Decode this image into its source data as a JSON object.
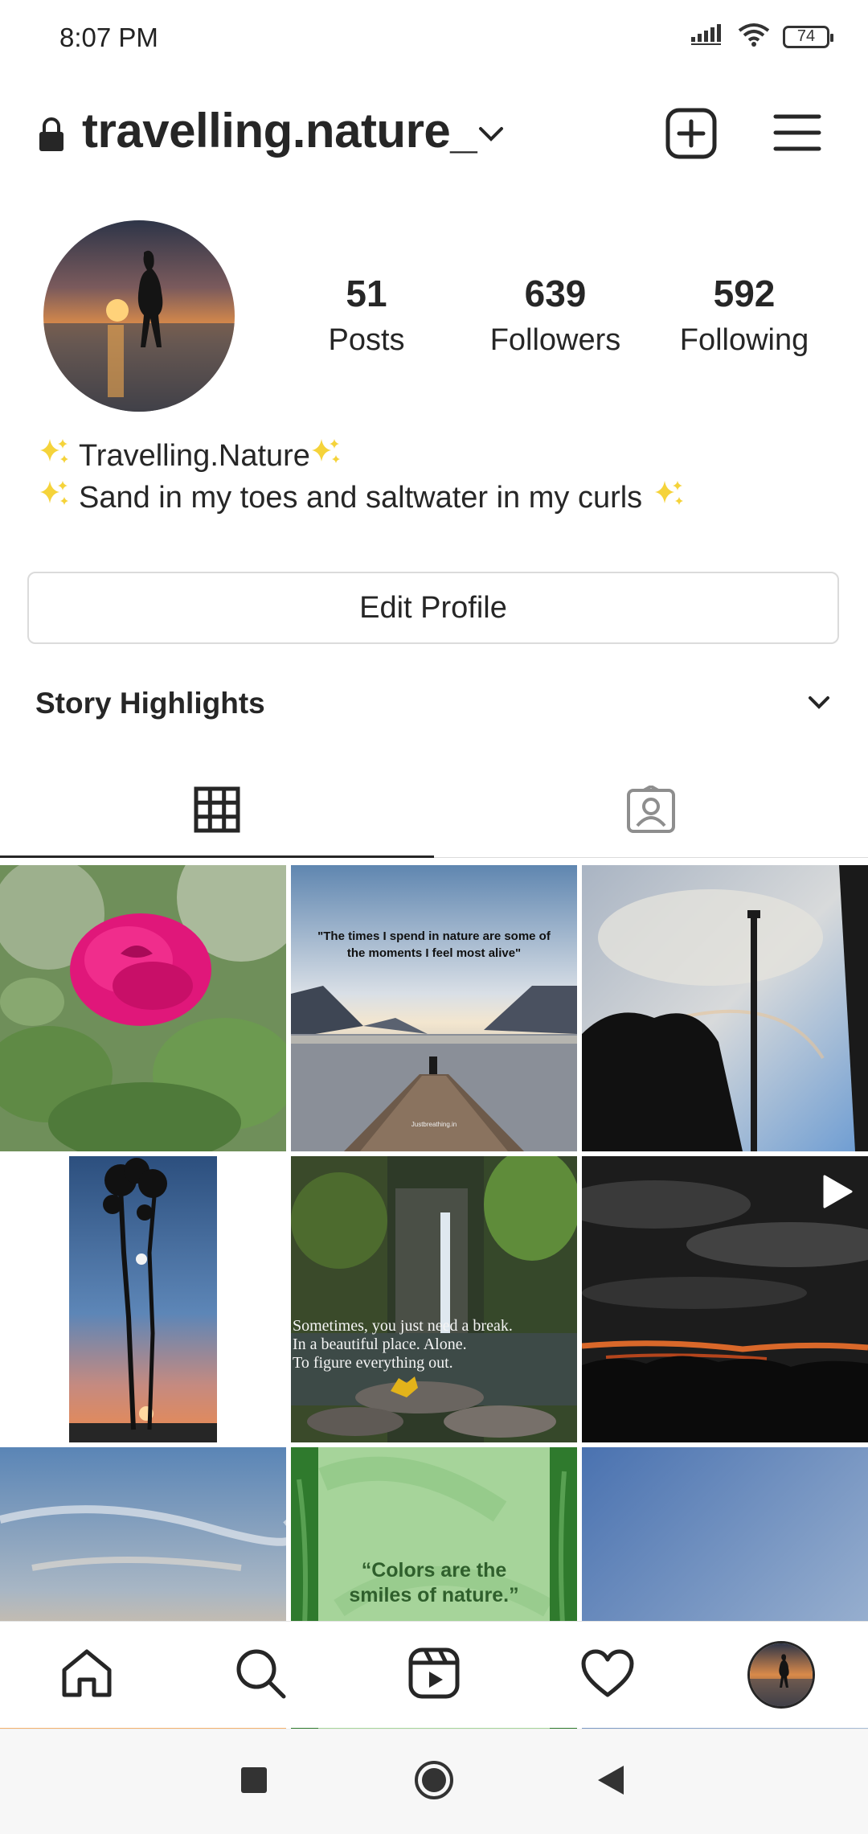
{
  "status_bar": {
    "time": "8:07 PM",
    "battery": "74",
    "icons": [
      "signal-icon",
      "wifi-icon",
      "battery-icon"
    ]
  },
  "header": {
    "username": "travelling.nature_",
    "icons": [
      "lock-icon",
      "chevron-down-icon",
      "new-post-icon",
      "menu-icon"
    ]
  },
  "profile": {
    "stats": [
      {
        "value": "51",
        "label": "Posts"
      },
      {
        "value": "639",
        "label": "Followers"
      },
      {
        "value": "592",
        "label": "Following"
      }
    ],
    "bio_name": "Travelling.Nature",
    "bio_text": "Sand in my toes and saltwater in my curls",
    "edit_button": "Edit Profile"
  },
  "highlights": {
    "title": "Story Highlights"
  },
  "tabs": [
    "grid-icon",
    "tagged-icon"
  ],
  "posts": [
    {
      "desc": "rose",
      "caption": ""
    },
    {
      "desc": "pier-lake",
      "caption": "\"The times I spend in nature are some of the moments I feel most alive\"",
      "credit": "Justbreathing.in"
    },
    {
      "desc": "sky-pole",
      "caption": ""
    },
    {
      "desc": "trees-sunset",
      "caption": ""
    },
    {
      "desc": "waterfall",
      "caption_lines": [
        "Sometimes, you just need a break.",
        "In a beautiful place. Alone.",
        "To figure everything out."
      ]
    },
    {
      "desc": "dark-clouds-video",
      "caption": ""
    },
    {
      "desc": "sunset-sky",
      "caption": ""
    },
    {
      "desc": "green-leaves-quote",
      "caption_lines": [
        "“Colors are the",
        "smiles of nature.”"
      ]
    },
    {
      "desc": "blue-sky",
      "caption": ""
    }
  ],
  "bottom_nav": [
    "home-icon",
    "search-icon",
    "reels-icon",
    "heart-icon",
    "profile-avatar"
  ],
  "system_nav": [
    "recents-button",
    "home-button",
    "back-button"
  ],
  "colors": {
    "text": "#262626",
    "border": "#dbdbdb",
    "sparkle": "#f5d33a"
  }
}
